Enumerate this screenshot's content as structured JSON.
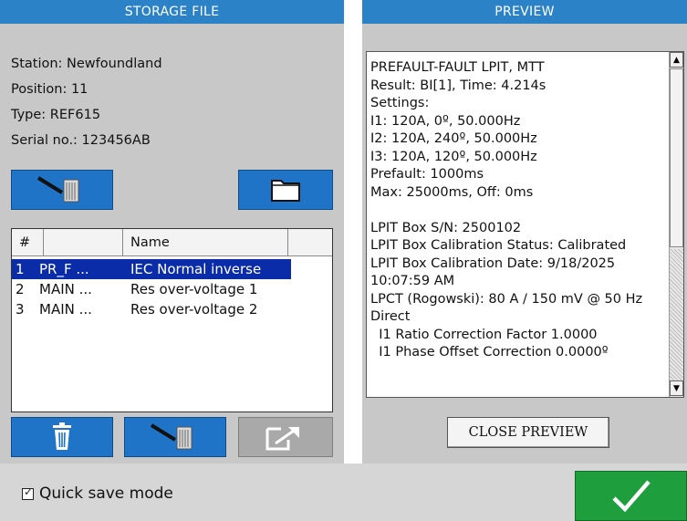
{
  "storage": {
    "header": "STORAGE FILE",
    "station": "Station: Newfoundland",
    "position": "Position: 11",
    "type": "Type: REF615",
    "serial": "Serial no.: 123456AB",
    "table": {
      "col_num": "#",
      "col_blank": "",
      "col_name": "Name",
      "rows": [
        {
          "num": "1",
          "code": "PR_F ...",
          "name": "IEC Normal inverse",
          "selected": true
        },
        {
          "num": "2",
          "code": "MAIN ...",
          "name": "Res over-voltage 1",
          "selected": false
        },
        {
          "num": "3",
          "code": "MAIN ...",
          "name": "Res over-voltage 2",
          "selected": false
        }
      ]
    }
  },
  "preview": {
    "header": "PREVIEW",
    "lines": [
      "PREFAULT-FAULT LPIT, MTT",
      "Result: BI[1], Time: 4.214s",
      "Settings:",
      "I1: 120A, 0º, 50.000Hz",
      "I2: 120A, 240º, 50.000Hz",
      "I3: 120A, 120º, 50.000Hz",
      "Prefault: 1000ms",
      "Max: 25000ms, Off: 0ms",
      "",
      "LPIT Box S/N: 2500102",
      "LPIT Box Calibration Status: Calibrated",
      "LPIT Box Calibration Date: 9/18/2025",
      "10:07:59 AM",
      "LPCT (Rogowski): 80 A / 150 mV @ 50 Hz",
      "Direct",
      "  I1 Ratio Correction Factor 1.0000",
      "  I1 Phase Offset Correction 0.0000º"
    ],
    "close_label": "CLOSE PREVIEW"
  },
  "footer": {
    "quick_save_label": "Quick save mode",
    "quick_save_checked": true
  },
  "icons": {
    "save_to_file": "save-to-file-icon",
    "folder": "folder-icon",
    "trash": "trash-icon",
    "save": "save-to-file-icon",
    "export": "export-icon",
    "check": "checkmark-icon"
  },
  "colors": {
    "header_blue": "#2c82c6",
    "button_blue": "#1f74c7",
    "selection": "#0a2ca8",
    "ok_green": "#1f9e3d"
  }
}
